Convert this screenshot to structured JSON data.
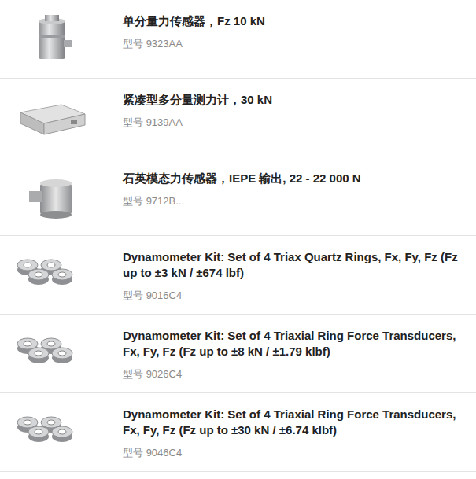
{
  "products": [
    {
      "title": "单分量力传感器，Fz 10 kN",
      "model_label": "型号",
      "model": "9323AA"
    },
    {
      "title": "紧凑型多分量测力计，30 kN",
      "model_label": "型号",
      "model": "9139AA"
    },
    {
      "title": "石英模态力传感器，IEPE 输出, 22 - 22 000 N",
      "model_label": "型号",
      "model": "9712B..."
    },
    {
      "title": "Dynamometer Kit: Set of 4 Triax Quartz Rings, Fx, Fy, Fz (Fz up to ±3 kN / ±674 lbf)",
      "model_label": "型号",
      "model": "9016C4"
    },
    {
      "title": "Dynamometer Kit: Set of 4 Triaxial Ring Force Transducers, Fx, Fy, Fz (Fz up to ±8 kN / ±1.79 klbf)",
      "model_label": "型号",
      "model": "9026C4"
    },
    {
      "title": "Dynamometer Kit: Set of 4 Triaxial Ring Force Transducers, Fx, Fy, Fz (Fz up to ±30 kN / ±6.74 klbf)",
      "model_label": "型号",
      "model": "9046C4"
    }
  ]
}
